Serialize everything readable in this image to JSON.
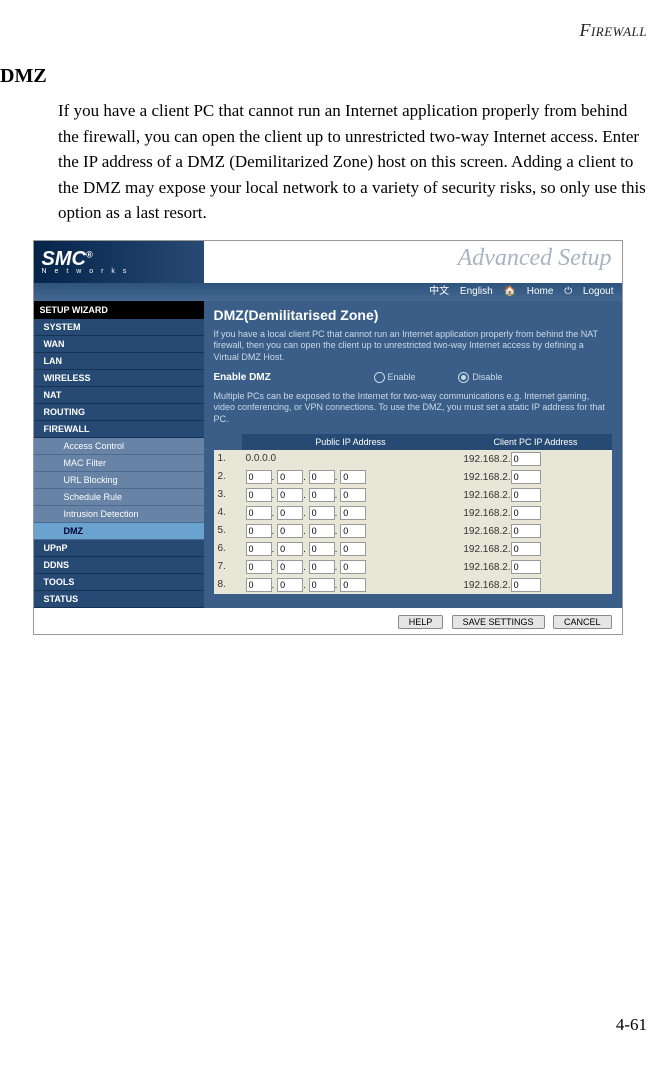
{
  "page": {
    "header": "Firewall",
    "section": "DMZ",
    "body": "If you have a client PC that cannot run an Internet application properly from behind the firewall, you can open the client up to unrestricted two-way Internet access. Enter the IP address of a DMZ (Demilitarized Zone) host on this screen. Adding a client to the DMZ may expose your local network to a variety of security risks, so only use this option as a last resort.",
    "number": "4-61"
  },
  "figure": {
    "logo": "SMC",
    "logo_reg": "®",
    "logo_sub": "N e t w o r k s",
    "adv": "Advanced Setup",
    "lang": {
      "cn": "中文",
      "en": "English",
      "home": "Home",
      "logout": "Logout"
    },
    "sidebar": {
      "setup": "SETUP WIZARD",
      "items": [
        "SYSTEM",
        "WAN",
        "LAN",
        "WIRELESS",
        "NAT",
        "ROUTING",
        "FIREWALL"
      ],
      "firewall_sub": [
        "Access Control",
        "MAC Filter",
        "URL Blocking",
        "Schedule Rule",
        "Intrusion Detection",
        "DMZ"
      ],
      "active_sub": "DMZ",
      "tail": [
        "UPnP",
        "DDNS",
        "TOOLS",
        "STATUS"
      ]
    },
    "content": {
      "title": "DMZ(Demilitarised Zone)",
      "desc1": "If you have a local client PC that cannot run an Internet application properly from behind the NAT firewall, then you can open the client up to unrestricted two-way Internet access by defining a Virtual DMZ Host.",
      "enable_label": "Enable DMZ",
      "enable_opt": "Enable",
      "disable_opt": "Disable",
      "selected": "Disable",
      "desc2": "Multiple PCs can be exposed to the Internet for two-way communications e.g. Internet gaming, video conferencing, or VPN connections.  To use the DMZ, you must set a static IP address for that PC.",
      "col_pub": "Public IP Address",
      "col_client": "Client PC IP Address",
      "client_prefix": "192.168.2.",
      "rows": [
        {
          "n": "1.",
          "pub": "0.0.0.0",
          "pub_static": true,
          "client": "0"
        },
        {
          "n": "2.",
          "pub": [
            "0",
            "0",
            "0",
            "0"
          ],
          "client": "0"
        },
        {
          "n": "3.",
          "pub": [
            "0",
            "0",
            "0",
            "0"
          ],
          "client": "0"
        },
        {
          "n": "4.",
          "pub": [
            "0",
            "0",
            "0",
            "0"
          ],
          "client": "0"
        },
        {
          "n": "5.",
          "pub": [
            "0",
            "0",
            "0",
            "0"
          ],
          "client": "0"
        },
        {
          "n": "6.",
          "pub": [
            "0",
            "0",
            "0",
            "0"
          ],
          "client": "0"
        },
        {
          "n": "7.",
          "pub": [
            "0",
            "0",
            "0",
            "0"
          ],
          "client": "0"
        },
        {
          "n": "8.",
          "pub": [
            "0",
            "0",
            "0",
            "0"
          ],
          "client": "0"
        }
      ],
      "buttons": {
        "help": "HELP",
        "save": "SAVE SETTINGS",
        "cancel": "CANCEL"
      }
    }
  }
}
